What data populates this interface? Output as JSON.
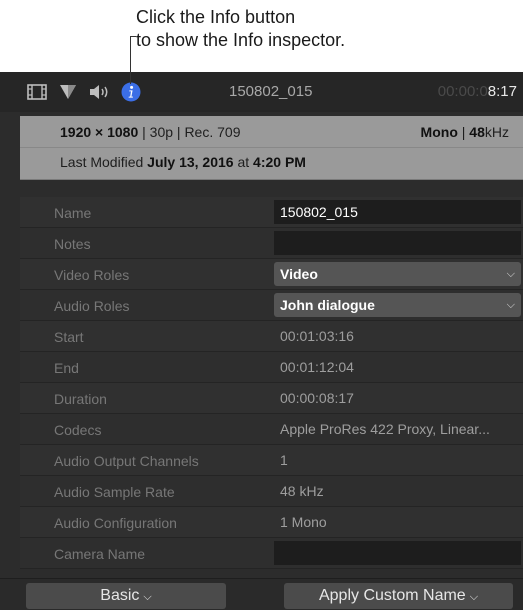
{
  "callout": {
    "line1": "Click the Info button",
    "line2": "to show the Info inspector."
  },
  "toolbar": {
    "icons": [
      "film-strip-icon",
      "marker-icon",
      "speaker-icon",
      "info-icon"
    ],
    "clip_name": "150802_015",
    "timecode_dim": "00:00:0",
    "timecode_bright": "8:17",
    "accent": "#3b6ee6"
  },
  "summary": {
    "resolution": "1920 × 1080",
    "format_rest": " | 30p | Rec. 709",
    "channels": "Mono",
    "rate": "48",
    "rate_unit": "kHz",
    "modified_prefix": "Last Modified ",
    "modified_date": "July 13, 2016",
    "modified_at": " at ",
    "modified_time": "4:20 PM"
  },
  "fields": [
    {
      "label": "Name",
      "value": "150802_015"
    },
    {
      "label": "Notes",
      "value": ""
    },
    {
      "label": "Video Roles",
      "value": "Video"
    },
    {
      "label": "Audio Roles",
      "value": "John dialogue"
    },
    {
      "label": "Start",
      "value": "00:01:03:16"
    },
    {
      "label": "End",
      "value": "00:01:12:04"
    },
    {
      "label": "Duration",
      "value": "00:00:08:17"
    },
    {
      "label": "Codecs",
      "value": "Apple ProRes 422 Proxy, Linear..."
    },
    {
      "label": "Audio Output Channels",
      "value": "1"
    },
    {
      "label": "Audio Sample Rate",
      "value": "48 kHz"
    },
    {
      "label": "Audio Configuration",
      "value": "1 Mono"
    },
    {
      "label": "Camera Name",
      "value": ""
    }
  ],
  "buttons": {
    "basic": "Basic",
    "apply": "Apply Custom Name"
  }
}
